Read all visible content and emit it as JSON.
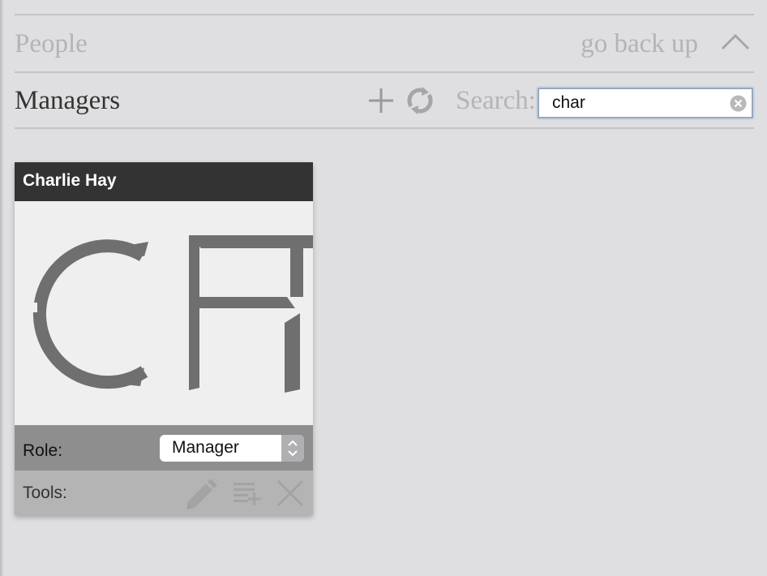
{
  "header": {
    "section_title": "People",
    "go_back_label": "go back up",
    "icons": {
      "collapse": "chevron-up-icon"
    }
  },
  "managers": {
    "title": "Managers",
    "icons": {
      "add": "plus-icon",
      "refresh": "refresh-icon",
      "clear": "clear-icon"
    },
    "search": {
      "label": "Search:",
      "value": "char",
      "placeholder": ""
    }
  },
  "cards": [
    {
      "name": "Charlie Hay",
      "initials": "CH",
      "role_label": "Role:",
      "role_value": "Manager",
      "tools_label": "Tools:",
      "tools": [
        "pencil-icon",
        "add-to-list-icon",
        "close-icon"
      ]
    }
  ],
  "colors": {
    "background": "#dfdfe1",
    "card_header": "#333333",
    "role_row": "#8e8e8e",
    "tools_row": "#b4b4b4",
    "muted_text": "#b4b4b6"
  }
}
